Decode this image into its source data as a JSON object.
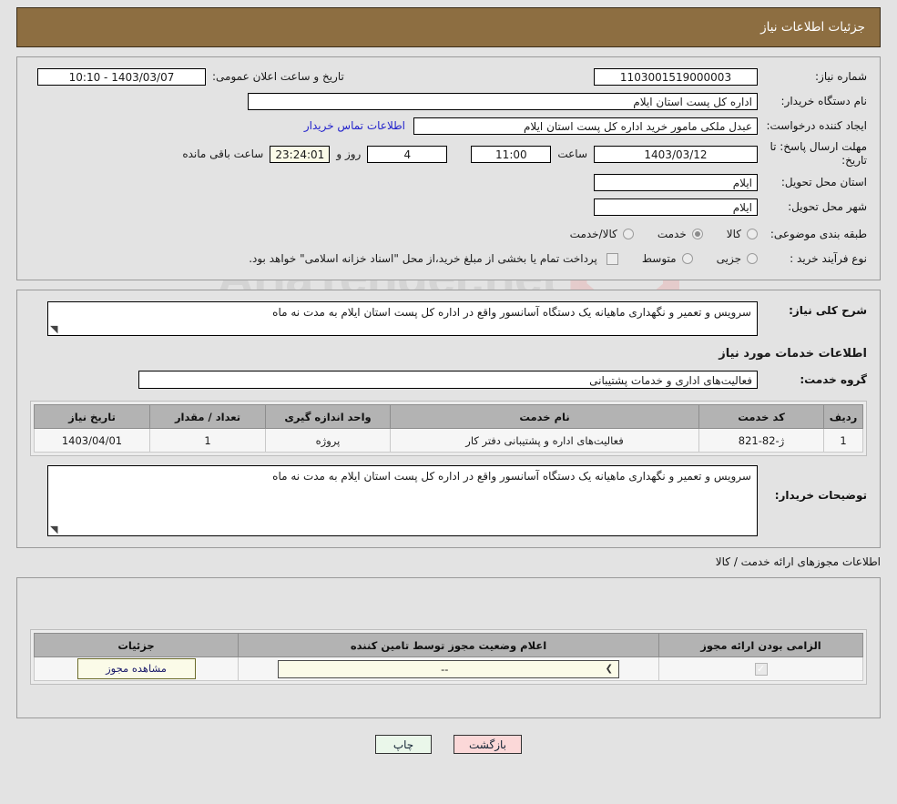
{
  "header": {
    "title": "جزئیات اطلاعات نیاز"
  },
  "watermark": {
    "text": "AriaTender.net"
  },
  "summary": {
    "need_number_label": "شماره نیاز:",
    "need_number_value": "1103001519000003",
    "announce_label": "تاریخ و ساعت اعلان عمومی:",
    "announce_value": "1403/03/07 - 10:10",
    "buyer_org_label": "نام دستگاه خریدار:",
    "buyer_org_value": "اداره کل پست استان ایلام",
    "creator_label": "ایجاد کننده درخواست:",
    "creator_value": "عبدل ملکی مامور خرید  اداره کل پست استان ایلام",
    "contact_link": "اطلاعات تماس خریدار",
    "deadline_label": "مهلت ارسال پاسخ: تا تاریخ:",
    "deadline_date": "1403/03/12",
    "hour_label": "ساعت",
    "deadline_time": "11:00",
    "days_value": "4",
    "days_label": "روز و",
    "countdown_value": "23:24:01",
    "remaining_label": "ساعت باقی مانده",
    "province_label": "استان محل تحویل:",
    "province_value": "ایلام",
    "city_label": "شهر محل تحویل:",
    "city_value": "ایلام",
    "category_label": "طبقه بندی موضوعی:",
    "category_options": [
      {
        "label": "کالا",
        "selected": false
      },
      {
        "label": "خدمت",
        "selected": true
      },
      {
        "label": "کالا/خدمت",
        "selected": false
      }
    ],
    "process_label": "نوع فرآیند خرید :",
    "process_options": [
      {
        "label": "جزیی",
        "selected": false
      },
      {
        "label": "متوسط",
        "selected": false
      }
    ],
    "treasury_note": "پرداخت تمام یا بخشی از مبلغ خرید،از محل \"اسناد خزانه اسلامی\" خواهد بود."
  },
  "details": {
    "need_desc_label": "شرح کلی نیاز:",
    "need_desc_value": "سرویس و تعمیر و نگهداری ماهیانه یک دستگاه آسانسور واقع در اداره کل پست استان ایلام به مدت نه ماه",
    "services_title": "اطلاعات خدمات مورد نیاز",
    "service_group_label": "گروه خدمت:",
    "service_group_value": "فعالیت‌های اداری و خدمات پشتیبانی",
    "table": {
      "columns": [
        "ردیف",
        "کد خدمت",
        "نام خدمت",
        "واحد اندازه گیری",
        "تعداد / مقدار",
        "تاریخ نیاز"
      ],
      "rows": [
        {
          "radif": "1",
          "code": "ژ-82-821",
          "name": "فعالیت‌های اداره و پشتیبانی دفتر کار",
          "unit": "پروژه",
          "qty": "1",
          "date": "1403/04/01"
        }
      ]
    },
    "buyer_notes_label": "توضیحات خریدار:",
    "buyer_notes_value": "سرویس و تعمیر و نگهداری ماهیانه یک دستگاه آسانسور واقع در اداره کل پست استان ایلام به مدت نه ماه"
  },
  "licenses": {
    "caption": "اطلاعات مجوزهای ارائه خدمت / کالا",
    "columns": [
      "الزامی بودن ارائه مجوز",
      "اعلام وضعیت مجوز توسط تامین کننده",
      "جزئیات"
    ],
    "rows": [
      {
        "required_checked": true,
        "status_value": "--",
        "details_button": "مشاهده مجوز"
      }
    ]
  },
  "footer": {
    "print_label": "چاپ",
    "back_label": "بازگشت"
  }
}
